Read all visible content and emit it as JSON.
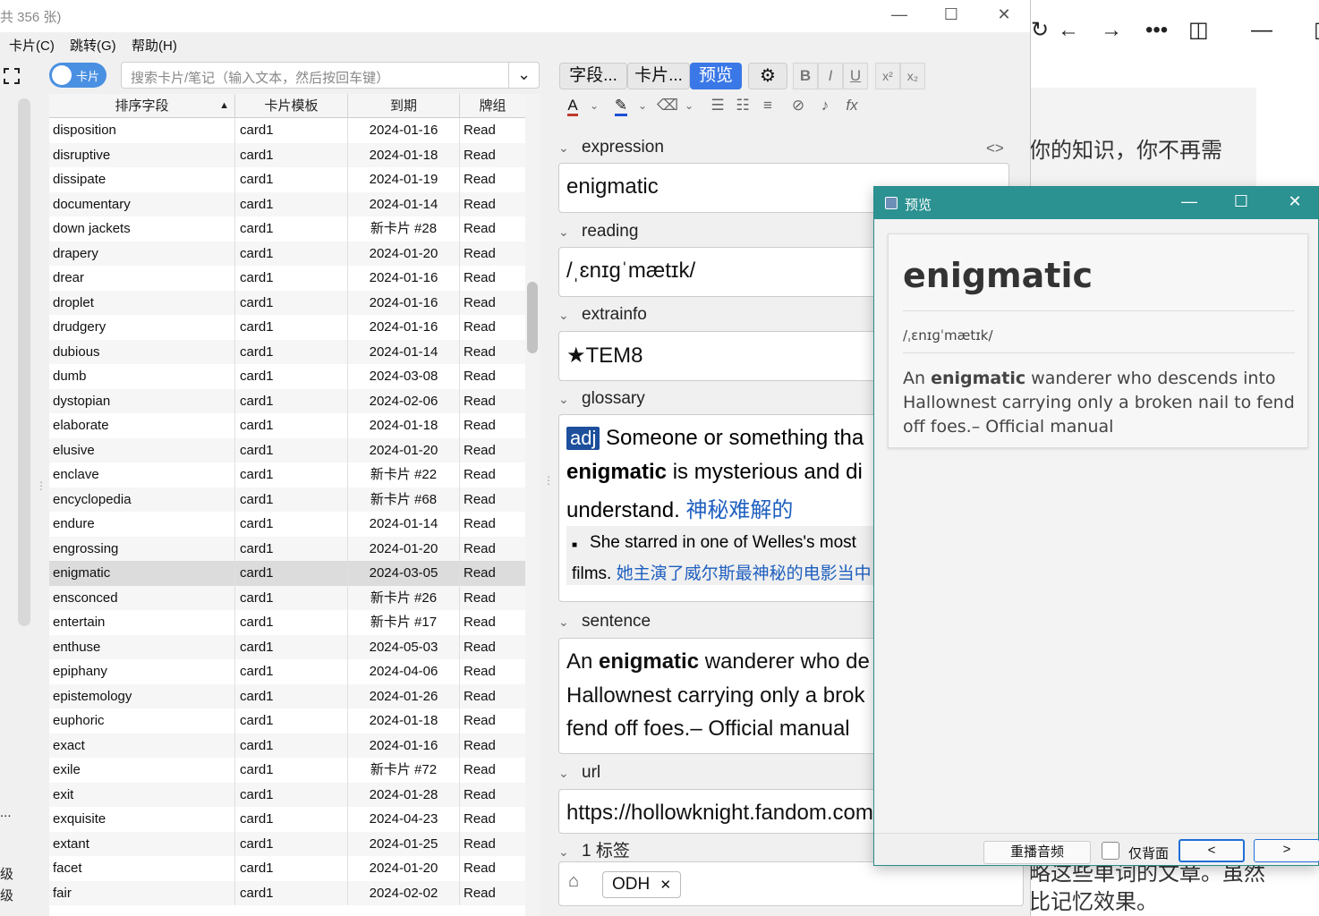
{
  "main_window": {
    "title_partial": "共 356 张)",
    "menu": [
      "卡片(C)",
      "跳转(G)",
      "帮助(H)"
    ],
    "toggle_label": "卡片",
    "search_placeholder": "搜索卡片/笔记（输入文本，然后按回车键）",
    "sidebar_partial": [
      "...",
      "级",
      "级"
    ]
  },
  "table": {
    "columns": [
      "排序字段",
      "卡片模板",
      "到期",
      "牌组"
    ],
    "sort_indicator": "▲",
    "rows": [
      [
        "disposition",
        "card1",
        "2024-01-16",
        "Read"
      ],
      [
        "disruptive",
        "card1",
        "2024-01-18",
        "Read"
      ],
      [
        "dissipate",
        "card1",
        "2024-01-19",
        "Read"
      ],
      [
        "documentary",
        "card1",
        "2024-01-14",
        "Read"
      ],
      [
        "down jackets",
        "card1",
        "新卡片 #28",
        "Read"
      ],
      [
        "drapery",
        "card1",
        "2024-01-20",
        "Read"
      ],
      [
        "drear",
        "card1",
        "2024-01-16",
        "Read"
      ],
      [
        "droplet",
        "card1",
        "2024-01-16",
        "Read"
      ],
      [
        "drudgery",
        "card1",
        "2024-01-16",
        "Read"
      ],
      [
        "dubious",
        "card1",
        "2024-01-14",
        "Read"
      ],
      [
        "dumb",
        "card1",
        "2024-03-08",
        "Read"
      ],
      [
        "dystopian",
        "card1",
        "2024-02-06",
        "Read"
      ],
      [
        "elaborate",
        "card1",
        "2024-01-18",
        "Read"
      ],
      [
        "elusive",
        "card1",
        "2024-01-20",
        "Read"
      ],
      [
        "enclave",
        "card1",
        "新卡片 #22",
        "Read"
      ],
      [
        "encyclopedia",
        "card1",
        "新卡片 #68",
        "Read"
      ],
      [
        "endure",
        "card1",
        "2024-01-14",
        "Read"
      ],
      [
        "engrossing",
        "card1",
        "2024-01-20",
        "Read"
      ],
      [
        "enigmatic",
        "card1",
        "2024-03-05",
        "Read"
      ],
      [
        "ensconced",
        "card1",
        "新卡片 #26",
        "Read"
      ],
      [
        "entertain",
        "card1",
        "新卡片 #17",
        "Read"
      ],
      [
        "enthuse",
        "card1",
        "2024-05-03",
        "Read"
      ],
      [
        "epiphany",
        "card1",
        "2024-04-06",
        "Read"
      ],
      [
        "epistemology",
        "card1",
        "2024-01-26",
        "Read"
      ],
      [
        "euphoric",
        "card1",
        "2024-01-18",
        "Read"
      ],
      [
        "exact",
        "card1",
        "2024-01-16",
        "Read"
      ],
      [
        "exile",
        "card1",
        "新卡片 #72",
        "Read"
      ],
      [
        "exit",
        "card1",
        "2024-01-28",
        "Read"
      ],
      [
        "exquisite",
        "card1",
        "2024-04-23",
        "Read"
      ],
      [
        "extant",
        "card1",
        "2024-01-25",
        "Read"
      ],
      [
        "facet",
        "card1",
        "2024-01-20",
        "Read"
      ],
      [
        "fair",
        "card1",
        "2024-02-02",
        "Read"
      ]
    ],
    "selected_index": 18
  },
  "editor": {
    "tabs": [
      "字段...",
      "卡片...",
      "预览"
    ],
    "format_buttons": [
      "B",
      "I",
      "U",
      "x²",
      "x₂"
    ],
    "fields": {
      "expression": {
        "label": "expression",
        "value": "enigmatic"
      },
      "reading": {
        "label": "reading",
        "value": "/ˌɛnɪɡˈmætɪk/"
      },
      "extrainfo": {
        "label": "extrainfo",
        "value": "★TEM8"
      },
      "glossary": {
        "label": "glossary",
        "pos": "adj",
        "line1": "Someone or something tha",
        "line2_bold": "enigmatic",
        "line2_rest": " is mysterious and di",
        "line3": "understand.",
        "line3_zh": "神秘难解的",
        "example_en": "She starred in one of Welles's most",
        "example_en2": "films.",
        "example_zh": "她主演了威尔斯最神秘的电影当中"
      },
      "sentence": {
        "label": "sentence",
        "line1_pre": "An ",
        "line1_bold": "enigmatic",
        "line1_post": " wanderer who de",
        "line2": "Hallownest carrying only a brok",
        "line3": "fend off foes.– Official manual"
      },
      "url": {
        "label": "url",
        "value": "https://hollowknight.fandom.com"
      }
    },
    "tags_label": "1 标签",
    "tags": [
      "ODH"
    ],
    "html_toggle": "<>"
  },
  "preview": {
    "title": "预览",
    "word": "enigmatic",
    "reading": "/ˌɛnɪɡˈmætɪk/",
    "sentence_pre": "An ",
    "sentence_bold": "enigmatic",
    "sentence_post": " wanderer who descends into Hallownest carrying only a broken nail to fend off foes.– Official manual",
    "replay_label": "重播音频",
    "back_only_label": "仅背面",
    "prev_label": "<",
    "next_label": ">"
  },
  "background": {
    "text1": "你的知识，你不再需",
    "text2": "略这些单词的文章。虽然",
    "text3": "比记忆效果。"
  },
  "colors": {
    "accent": "#3b78e7",
    "preview_titlebar": "#2b9191",
    "selected_row": "#dcdcdc"
  }
}
